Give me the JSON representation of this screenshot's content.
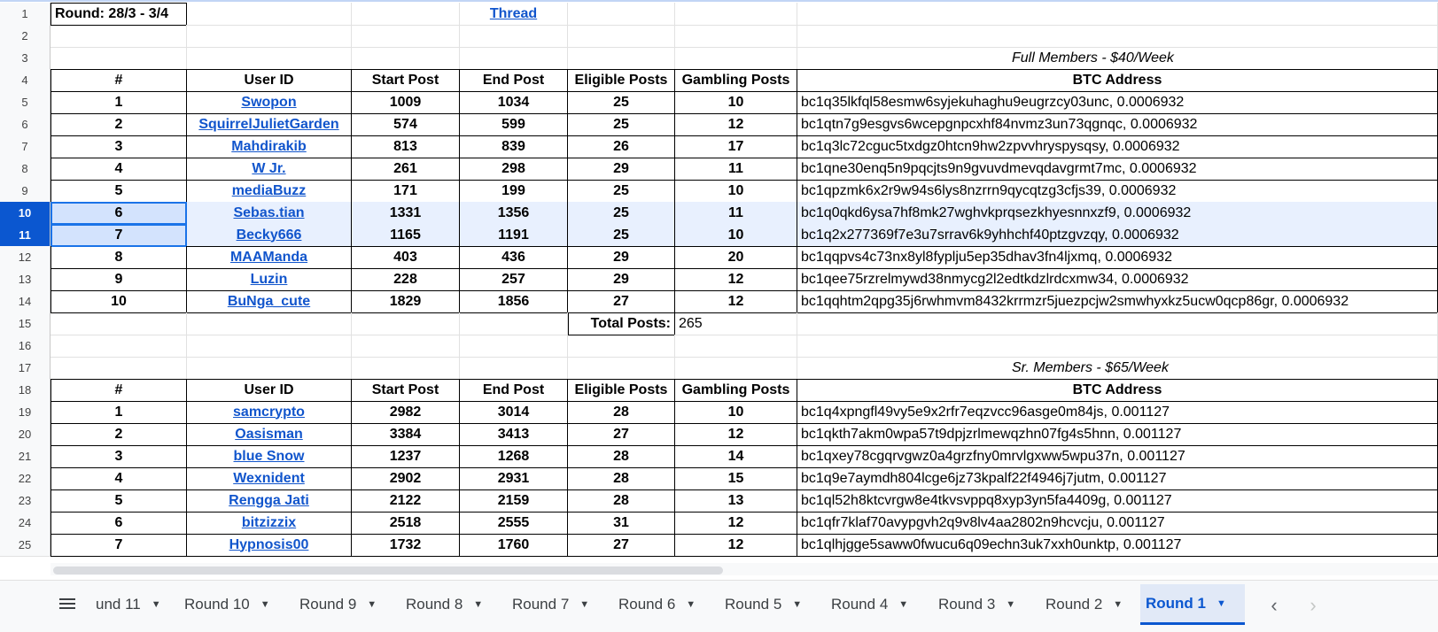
{
  "header": {
    "round_label": "Round: 28/3 - 3/4",
    "thread_link": "Thread"
  },
  "row_numbers": [
    "1",
    "2",
    "3",
    "4",
    "5",
    "6",
    "7",
    "8",
    "9",
    "10",
    "11",
    "12",
    "13",
    "14",
    "15",
    "16",
    "17",
    "18",
    "19",
    "20",
    "21",
    "22",
    "23",
    "24",
    "25"
  ],
  "selected_rows": [
    "10",
    "11"
  ],
  "columns": [
    "#",
    "User ID",
    "Start Post",
    "End Post",
    "Eligible Posts",
    "Gambling Posts",
    "BTC Address"
  ],
  "full_members": {
    "section_title": "Full Members - $40/Week",
    "rows": [
      [
        "1",
        "Swopon",
        "1009",
        "1034",
        "25",
        "10",
        "bc1q35lkfql58esmw6syjekuhaghu9eugrzcy03unc, 0.0006932"
      ],
      [
        "2",
        "SquirrelJulietGarden",
        "574",
        "599",
        "25",
        "12",
        "bc1qtn7g9esgvs6wcepgnpcxhf84nvmz3un73qgnqc, 0.0006932"
      ],
      [
        "3",
        "Mahdirakib",
        "813",
        "839",
        "26",
        "17",
        "bc1q3lc72cguc5txdgz0htcn9hw2zpvvhryspysqsy, 0.0006932"
      ],
      [
        "4",
        "W Jr.",
        "261",
        "298",
        "29",
        "11",
        "bc1qne30enq5n9pqcjts9n9gvuvdmevqdavgrmt7mc, 0.0006932"
      ],
      [
        "5",
        "mediaBuzz",
        "171",
        "199",
        "25",
        "10",
        "bc1qpzmk6x2r9w94s6lys8nzrrn9qycqtzg3cfjs39, 0.0006932"
      ],
      [
        "6",
        "Sebas.tian",
        "1331",
        "1356",
        "25",
        "11",
        "bc1q0qkd6ysa7hf8mk27wghvkprqsezkhyesnnxzf9, 0.0006932"
      ],
      [
        "7",
        "Becky666",
        "1165",
        "1191",
        "25",
        "10",
        "bc1q2x277369f7e3u7srrav6k9yhhchf40ptzgvzqy, 0.0006932"
      ],
      [
        "8",
        "MAAManda",
        "403",
        "436",
        "29",
        "20",
        "bc1qqpvs4c73nx8yl8fyplju5ep35dhav3fn4ljxmq, 0.0006932"
      ],
      [
        "9",
        "Luzin",
        "228",
        "257",
        "29",
        "12",
        "bc1qee75rzrelmywd38nmycg2l2edtkdzlrdcxmw34, 0.0006932"
      ],
      [
        "10",
        "BuNga_cute",
        "1829",
        "1856",
        "27",
        "12",
        "bc1qqhtm2qpg35j6rwhmvm8432krrmzr5juezpcjw2smwhyxkz5ucw0qcp86gr, 0.0006932"
      ]
    ],
    "total_label": "Total Posts:",
    "total_value": "265"
  },
  "sr_members": {
    "section_title": "Sr. Members - $65/Week",
    "rows": [
      [
        "1",
        "samcrypto",
        "2982",
        "3014",
        "28",
        "10",
        "bc1q4xpngfl49vy5e9x2rfr7eqzvcc96asge0m84js, 0.001127"
      ],
      [
        "2",
        "Oasisman",
        "3384",
        "3413",
        "27",
        "12",
        "bc1qkth7akm0wpa57t9dpjzrlmewqzhn07fg4s5hnn, 0.001127"
      ],
      [
        "3",
        "blue Snow",
        "1237",
        "1268",
        "28",
        "14",
        "bc1qxey78cgqrvgwz0a4grzfny0mrvlgxww5wpu37n, 0.001127"
      ],
      [
        "4",
        "Wexnident",
        "2902",
        "2931",
        "28",
        "15",
        "bc1q9e7aymdh804lcge6jz73kpalf22f4946j7jutm, 0.001127"
      ],
      [
        "5",
        "Rengga Jati",
        "2122",
        "2159",
        "28",
        "13",
        "bc1ql52h8ktcvrgw8e4tkvsvppq8xyp3yn5fa4409g, 0.001127"
      ],
      [
        "6",
        "bitzizzix",
        "2518",
        "2555",
        "31",
        "12",
        "bc1qfr7klaf70avypgvh2q9v8lv4aa2802n9hcvcju, 0.001127"
      ],
      [
        "7",
        "Hypnosis00",
        "1732",
        "1760",
        "27",
        "12",
        "bc1qlhjgge5saww0fwucu6q09echn3uk7xxh0unktp, 0.001127"
      ]
    ]
  },
  "sheet_tabs": [
    {
      "label": "und 11",
      "active": false
    },
    {
      "label": "Round 10",
      "active": false
    },
    {
      "label": "Round 9",
      "active": false
    },
    {
      "label": "Round 8",
      "active": false
    },
    {
      "label": "Round 7",
      "active": false
    },
    {
      "label": "Round 6",
      "active": false
    },
    {
      "label": "Round 5",
      "active": false
    },
    {
      "label": "Round 4",
      "active": false
    },
    {
      "label": "Round 3",
      "active": false
    },
    {
      "label": "Round 2",
      "active": false
    },
    {
      "label": "Round 1",
      "active": true
    }
  ],
  "icons": {
    "menu": "all-sheets-menu-icon",
    "prev": "scroll-tabs-left-icon",
    "next": "scroll-tabs-right-icon"
  }
}
